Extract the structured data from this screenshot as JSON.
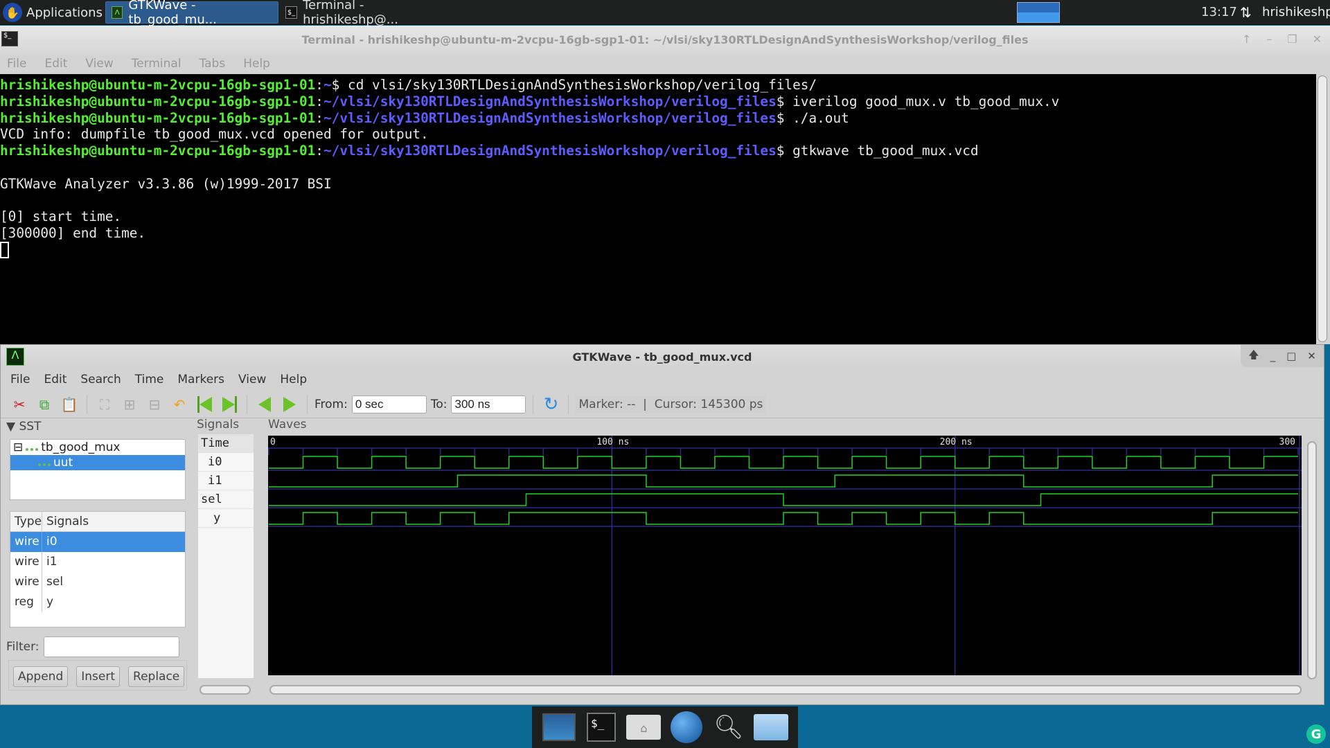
{
  "top_panel": {
    "applications_label": "Applications",
    "tasks": [
      {
        "label": "GTKWave - tb_good_mu...",
        "icon": "gtkwave-icon",
        "active": true
      },
      {
        "label": "Terminal - hrishikeshp@...",
        "icon": "terminal-icon",
        "active": false
      }
    ],
    "clock": "13:17",
    "network_icon": "⇅",
    "user": "hrishikeshp"
  },
  "terminal": {
    "title": "Terminal - hrishikeshp@ubuntu-m-2vcpu-16gb-sgp1-01: ~/vlsi/sky130RTLDesignAndSynthesisWorkshop/verilog_files",
    "menu": [
      "File",
      "Edit",
      "View",
      "Terminal",
      "Tabs",
      "Help"
    ],
    "prompt_user_host": "hrishikeshp@ubuntu-m-2vcpu-16gb-sgp1-01",
    "lines": [
      {
        "type": "prompt",
        "path": "~",
        "cmd": " cd vlsi/sky130RTLDesignAndSynthesisWorkshop/verilog_files/"
      },
      {
        "type": "prompt",
        "path": "~/vlsi/sky130RTLDesignAndSynthesisWorkshop/verilog_files",
        "cmd": " iverilog good_mux.v tb_good_mux.v"
      },
      {
        "type": "prompt",
        "path": "~/vlsi/sky130RTLDesignAndSynthesisWorkshop/verilog_files",
        "cmd": " ./a.out"
      },
      {
        "type": "output",
        "text": "VCD info: dumpfile tb_good_mux.vcd opened for output."
      },
      {
        "type": "prompt",
        "path": "~/vlsi/sky130RTLDesignAndSynthesisWorkshop/verilog_files",
        "cmd": " gtkwave tb_good_mux.vcd"
      },
      {
        "type": "output",
        "text": ""
      },
      {
        "type": "output",
        "text": "GTKWave Analyzer v3.3.86 (w)1999-2017 BSI"
      },
      {
        "type": "output",
        "text": ""
      },
      {
        "type": "output",
        "text": "[0] start time."
      },
      {
        "type": "output",
        "text": "[300000] end time."
      }
    ]
  },
  "gtkwave": {
    "title": "GTKWave - tb_good_mux.vcd",
    "menu": [
      "File",
      "Edit",
      "Search",
      "Time",
      "Markers",
      "View",
      "Help"
    ],
    "toolbar": {
      "from_label": "From:",
      "from_value": "0 sec",
      "to_label": "To:",
      "to_value": "300 ns",
      "marker": "Marker: --",
      "separator": "|",
      "cursor": "Cursor: 145300 ps"
    },
    "sst": {
      "header": "SST",
      "tree": [
        {
          "label": "tb_good_mux",
          "selected": false,
          "depth": 0
        },
        {
          "label": "uut",
          "selected": true,
          "depth": 1
        }
      ],
      "columns": [
        "Type",
        "Signals"
      ],
      "signals": [
        {
          "type": "wire",
          "name": "i0",
          "selected": true
        },
        {
          "type": "wire",
          "name": "i1",
          "selected": false
        },
        {
          "type": "wire",
          "name": "sel",
          "selected": false
        },
        {
          "type": "reg",
          "name": "y",
          "selected": false
        }
      ],
      "filter_label": "Filter:",
      "filter_value": "",
      "buttons": [
        "Append",
        "Insert",
        "Replace"
      ]
    },
    "signals_pane": {
      "header": "Signals",
      "time_label": "Time",
      "names": [
        "i0",
        "i1",
        "sel",
        "y"
      ]
    },
    "waves_pane": {
      "header": "Waves",
      "time_range_ns": [
        0,
        300
      ],
      "cursor_ps": 145300,
      "axis_labels": [
        {
          "t": 0,
          "text": "0"
        },
        {
          "t": 100,
          "text": "100 ns"
        },
        {
          "t": 200,
          "text": "200 ns"
        },
        {
          "t": 300,
          "text": "300"
        }
      ],
      "signals": [
        {
          "name": "i0",
          "initial": 0,
          "toggle_times_ns": [
            10,
            20,
            30,
            40,
            50,
            60,
            70,
            80,
            90,
            100,
            110,
            120,
            130,
            140,
            150,
            160,
            170,
            180,
            190,
            200,
            210,
            220,
            230,
            240,
            250,
            260,
            270,
            280,
            290
          ]
        },
        {
          "name": "i1",
          "initial": 0,
          "toggle_times_ns": [
            55,
            110,
            165,
            220,
            275
          ]
        },
        {
          "name": "sel",
          "initial": 0,
          "toggle_times_ns": [
            75,
            150,
            225
          ]
        },
        {
          "name": "y",
          "initial": 0,
          "toggle_times_ns": [
            10,
            20,
            30,
            40,
            50,
            60,
            70,
            110,
            150,
            160,
            170,
            180,
            190,
            200,
            210,
            220,
            275
          ]
        }
      ],
      "colors": {
        "wave": "#22d222",
        "grid": "#2a2a8a",
        "background": "#000000",
        "axis_text": "#e0e0e0"
      }
    }
  },
  "dock": {
    "items": [
      "show-desktop-icon",
      "terminal-icon",
      "home-folder-icon",
      "web-browser-icon",
      "search-icon",
      "files-icon"
    ]
  }
}
